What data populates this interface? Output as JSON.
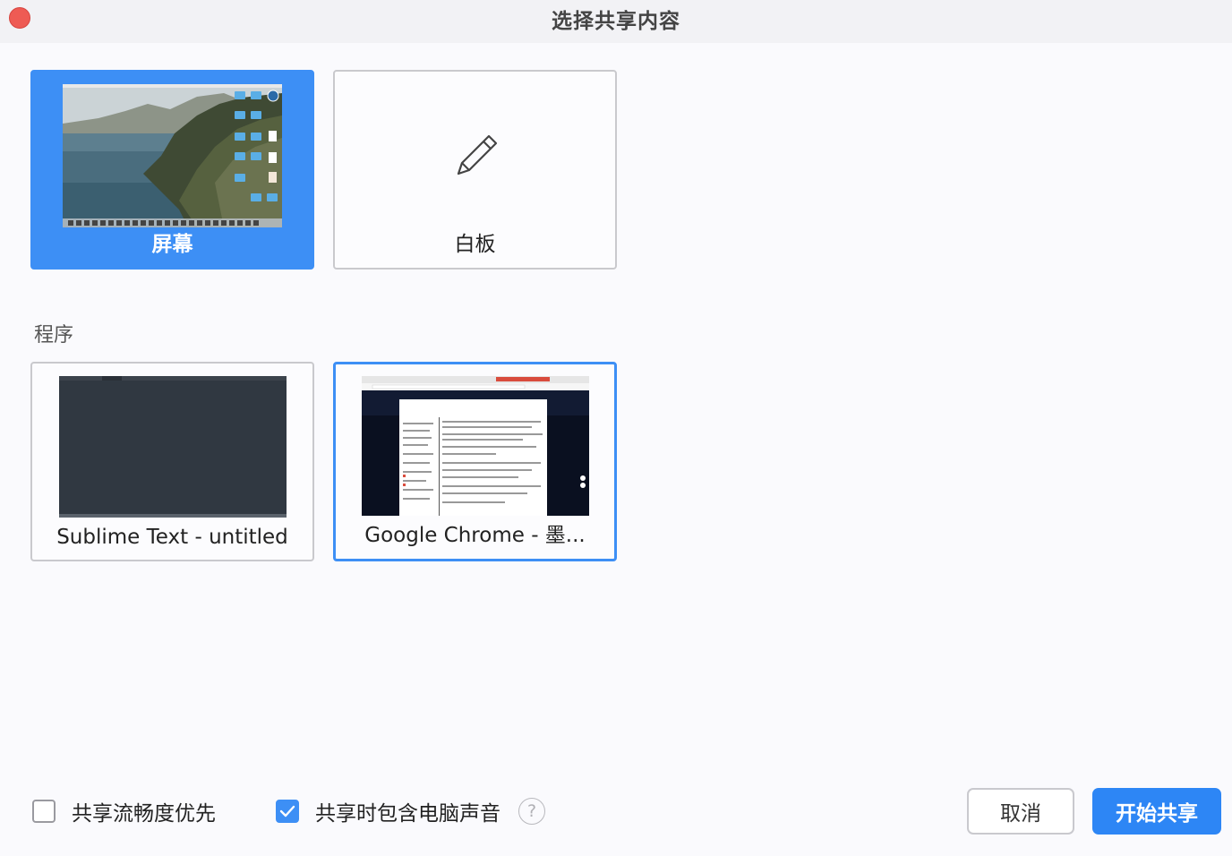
{
  "window": {
    "title": "选择共享内容"
  },
  "tiles": {
    "screen": {
      "label": "屏幕",
      "selected": true
    },
    "whiteboard": {
      "label": "白板"
    }
  },
  "programs": {
    "section_label": "程序",
    "items": [
      {
        "label": "Sublime Text - untitled"
      },
      {
        "label": "Google Chrome - 墨...",
        "selected": true
      }
    ]
  },
  "options": {
    "smooth": {
      "label": "共享流畅度优先",
      "checked": false
    },
    "audio": {
      "label": "共享时包含电脑声音",
      "checked": true
    },
    "help_glyph": "?"
  },
  "buttons": {
    "cancel": "取消",
    "start": "开始共享"
  },
  "colors": {
    "accent": "#3d8ff5",
    "primary_button": "#2d86f5",
    "close": "#ee5b54"
  }
}
